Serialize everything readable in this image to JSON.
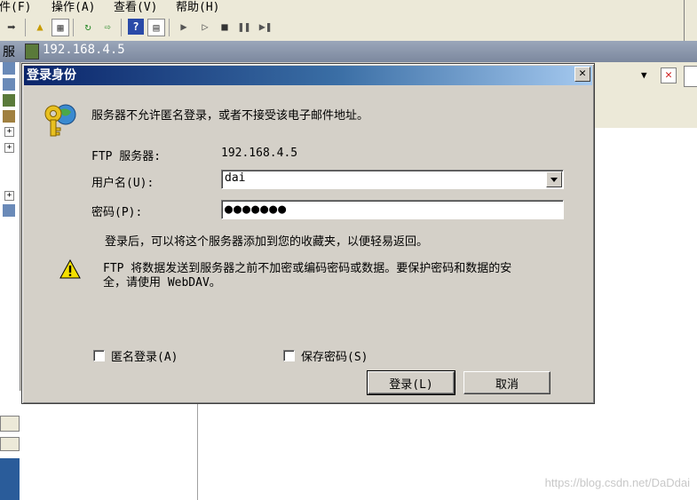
{
  "menubar": {
    "file": "文件(F)",
    "action": "操作(A)",
    "view": "查看(V)",
    "help": "帮助(H)"
  },
  "addressbar": {
    "address": "192.168.4.5"
  },
  "leftpane": {
    "label": "服"
  },
  "dialog": {
    "title": "登录身份",
    "message": "服务器不允许匿名登录，或者不接受该电子邮件地址。",
    "ftp_server_label": "FTP 服务器:",
    "ftp_server_value": "192.168.4.5",
    "username_label": "用户名(U):",
    "username_value": "dai",
    "password_label": "密码(P):",
    "password_mask": "●●●●●●●",
    "favorites_note": "登录后，可以将这个服务器添加到您的收藏夹，以便轻易返回。",
    "warning_line1": "FTP 将数据发送到服务器之前不加密或编码密码或数据。要保护密码和数据的安",
    "warning_line2": "全，请使用 WebDAV。",
    "anonymous_label": "匿名登录(A)",
    "save_password_label": "保存密码(S)",
    "login_button": "登录(L)",
    "cancel_button": "取消"
  },
  "watermark": "https://blog.csdn.net/DaDdai",
  "colors": {
    "title_start": "#0a246a",
    "title_end": "#a6caf0",
    "face": "#d4d0c8"
  }
}
